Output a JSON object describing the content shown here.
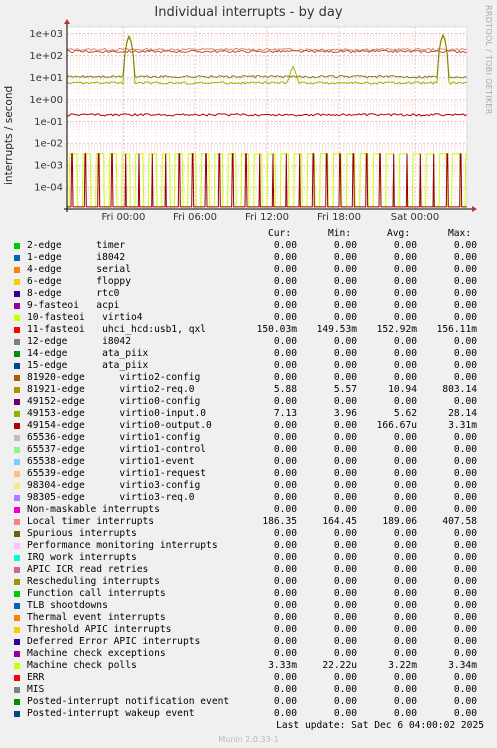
{
  "window": {
    "title": "Individual interrupts - by day",
    "side_label": "RRDTOOL / TOBI OETIKER",
    "last_update": "Last update:  Sat Dec  6 04:00:02 2025",
    "footer": "Munin 2.0.33-1"
  },
  "chart_data": {
    "type": "line",
    "title": "Individual interrupts - by day",
    "ylabel": "interrupts / second",
    "yscale": "log",
    "ylim": [
      1e-05,
      2000
    ],
    "y_ticks": [
      "1e+03",
      "1e+02",
      "1e+01",
      "1e+00",
      "1e-01",
      "1e-02",
      "1e-03",
      "1e-04"
    ],
    "x_ticks": [
      "Fri 00:00",
      "Fri 06:00",
      "Fri 12:00",
      "Fri 18:00",
      "Sat 00:00"
    ],
    "grid": true,
    "series": [
      {
        "name": "Local timer interrupts",
        "color": "#f0797b",
        "approx_level": 189.06,
        "spikes": []
      },
      {
        "name": "11-fasteoi uhci_hcd:usb1, qxl",
        "color": "#a06030",
        "approx_level": 152.92,
        "spikes": []
      },
      {
        "name": "49153-edge virtio0-input.0",
        "color": "#a0b000",
        "approx_level": 5.62,
        "spikes": [
          [
            0.155,
            800
          ],
          [
            0.565,
            25
          ],
          [
            0.94,
            900
          ]
        ]
      },
      {
        "name": "81921-edge virtio2-req.0",
        "color": "#808000",
        "approx_level": 10.94,
        "spikes": [
          [
            0.155,
            700
          ],
          [
            0.94,
            800
          ]
        ]
      },
      {
        "name": "Machine check polls",
        "color": "#bb0000",
        "approx_level": 0.2,
        "spikes": []
      },
      {
        "name": "10-fasteoi virtio4",
        "color": "#ccff00",
        "approx_level": 0.0033,
        "spikes": []
      },
      {
        "name": "49154-edge virtio0-output.0",
        "color": "#990000",
        "approx_level": 0.0033,
        "spikes": []
      }
    ]
  },
  "legend": {
    "headers": {
      "cur": "Cur:",
      "min": "Min:",
      "avg": "Avg:",
      "max": "Max:"
    },
    "rows": [
      {
        "label": "2-edge      timer",
        "color": "#00cc00",
        "cur": "0.00",
        "min": "0.00",
        "avg": "0.00",
        "max": "0.00"
      },
      {
        "label": "1-edge      i8042",
        "color": "#0066b3",
        "cur": "0.00",
        "min": "0.00",
        "avg": "0.00",
        "max": "0.00"
      },
      {
        "label": "4-edge      serial",
        "color": "#ff8000",
        "cur": "0.00",
        "min": "0.00",
        "avg": "0.00",
        "max": "0.00"
      },
      {
        "label": "6-edge      floppy",
        "color": "#ffcc00",
        "cur": "0.00",
        "min": "0.00",
        "avg": "0.00",
        "max": "0.00"
      },
      {
        "label": "8-edge      rtc0",
        "color": "#330099",
        "cur": "0.00",
        "min": "0.00",
        "avg": "0.00",
        "max": "0.00"
      },
      {
        "label": "9-fasteoi   acpi",
        "color": "#990099",
        "cur": "0.00",
        "min": "0.00",
        "avg": "0.00",
        "max": "0.00"
      },
      {
        "label": "10-fasteoi   virtio4",
        "color": "#ccff00",
        "cur": "0.00",
        "min": "0.00",
        "avg": "0.00",
        "max": "0.00"
      },
      {
        "label": "11-fasteoi   uhci_hcd:usb1, qxl",
        "color": "#ff0000",
        "cur": "150.03m",
        "min": "149.53m",
        "avg": "152.92m",
        "max": "156.11m"
      },
      {
        "label": "12-edge      i8042",
        "color": "#808080",
        "cur": "0.00",
        "min": "0.00",
        "avg": "0.00",
        "max": "0.00"
      },
      {
        "label": "14-edge      ata_piix",
        "color": "#008f00",
        "cur": "0.00",
        "min": "0.00",
        "avg": "0.00",
        "max": "0.00"
      },
      {
        "label": "15-edge      ata_piix",
        "color": "#00487d",
        "cur": "0.00",
        "min": "0.00",
        "avg": "0.00",
        "max": "0.00"
      },
      {
        "label": "81920-edge      virtio2-config",
        "color": "#b35a00",
        "cur": "0.00",
        "min": "0.00",
        "avg": "0.00",
        "max": "0.00"
      },
      {
        "label": "81921-edge      virtio2-req.0",
        "color": "#b38f00",
        "cur": "5.88",
        "min": "5.57",
        "avg": "10.94",
        "max": "803.14"
      },
      {
        "label": "49152-edge      virtio0-config",
        "color": "#6b006b",
        "cur": "0.00",
        "min": "0.00",
        "avg": "0.00",
        "max": "0.00"
      },
      {
        "label": "49153-edge      virtio0-input.0",
        "color": "#8fb300",
        "cur": "7.13",
        "min": "3.96",
        "avg": "5.62",
        "max": "28.14"
      },
      {
        "label": "49154-edge      virtio0-output.0",
        "color": "#b30000",
        "cur": "0.00",
        "min": "0.00",
        "avg": "166.67u",
        "max": "3.31m"
      },
      {
        "label": "65536-edge      virtio1-config",
        "color": "#bebebe",
        "cur": "0.00",
        "min": "0.00",
        "avg": "0.00",
        "max": "0.00"
      },
      {
        "label": "65537-edge      virtio1-control",
        "color": "#80ff80",
        "cur": "0.00",
        "min": "0.00",
        "avg": "0.00",
        "max": "0.00"
      },
      {
        "label": "65538-edge      virtio1-event",
        "color": "#80c9ff",
        "cur": "0.00",
        "min": "0.00",
        "avg": "0.00",
        "max": "0.00"
      },
      {
        "label": "65539-edge      virtio1-request",
        "color": "#ffc080",
        "cur": "0.00",
        "min": "0.00",
        "avg": "0.00",
        "max": "0.00"
      },
      {
        "label": "98304-edge      virtio3-config",
        "color": "#ffe680",
        "cur": "0.00",
        "min": "0.00",
        "avg": "0.00",
        "max": "0.00"
      },
      {
        "label": "98305-edge      virtio3-req.0",
        "color": "#aa80ff",
        "cur": "0.00",
        "min": "0.00",
        "avg": "0.00",
        "max": "0.00"
      },
      {
        "label": "Non-maskable interrupts",
        "color": "#ee00cc",
        "cur": "0.00",
        "min": "0.00",
        "avg": "0.00",
        "max": "0.00"
      },
      {
        "label": "Local timer interrupts",
        "color": "#ff8080",
        "cur": "186.35",
        "min": "164.45",
        "avg": "189.06",
        "max": "407.58"
      },
      {
        "label": "Spurious interrupts",
        "color": "#666600",
        "cur": "0.00",
        "min": "0.00",
        "avg": "0.00",
        "max": "0.00"
      },
      {
        "label": "Performance monitoring interrupts",
        "color": "#ffbfff",
        "cur": "0.00",
        "min": "0.00",
        "avg": "0.00",
        "max": "0.00"
      },
      {
        "label": "IRQ work interrupts",
        "color": "#00ffcc",
        "cur": "0.00",
        "min": "0.00",
        "avg": "0.00",
        "max": "0.00"
      },
      {
        "label": "APIC ICR read retries",
        "color": "#cc6699",
        "cur": "0.00",
        "min": "0.00",
        "avg": "0.00",
        "max": "0.00"
      },
      {
        "label": "Rescheduling interrupts",
        "color": "#999900",
        "cur": "0.00",
        "min": "0.00",
        "avg": "0.00",
        "max": "0.00"
      },
      {
        "label": "Function call interrupts",
        "color": "#00cc00",
        "cur": "0.00",
        "min": "0.00",
        "avg": "0.00",
        "max": "0.00"
      },
      {
        "label": "TLB shootdowns",
        "color": "#0066b3",
        "cur": "0.00",
        "min": "0.00",
        "avg": "0.00",
        "max": "0.00"
      },
      {
        "label": "Thermal event interrupts",
        "color": "#ff8000",
        "cur": "0.00",
        "min": "0.00",
        "avg": "0.00",
        "max": "0.00"
      },
      {
        "label": "Threshold APIC interrupts",
        "color": "#ffcc00",
        "cur": "0.00",
        "min": "0.00",
        "avg": "0.00",
        "max": "0.00"
      },
      {
        "label": "Deferred Error APIC interrupts",
        "color": "#330099",
        "cur": "0.00",
        "min": "0.00",
        "avg": "0.00",
        "max": "0.00"
      },
      {
        "label": "Machine check exceptions",
        "color": "#990099",
        "cur": "0.00",
        "min": "0.00",
        "avg": "0.00",
        "max": "0.00"
      },
      {
        "label": "Machine check polls",
        "color": "#ccff00",
        "cur": "3.33m",
        "min": "22.22u",
        "avg": "3.22m",
        "max": "3.34m"
      },
      {
        "label": "ERR",
        "color": "#ff0000",
        "cur": "0.00",
        "min": "0.00",
        "avg": "0.00",
        "max": "0.00"
      },
      {
        "label": "MIS",
        "color": "#808080",
        "cur": "0.00",
        "min": "0.00",
        "avg": "0.00",
        "max": "0.00"
      },
      {
        "label": "Posted-interrupt notification event",
        "color": "#008f00",
        "cur": "0.00",
        "min": "0.00",
        "avg": "0.00",
        "max": "0.00"
      },
      {
        "label": "Posted-interrupt wakeup event",
        "color": "#00487d",
        "cur": "0.00",
        "min": "0.00",
        "avg": "0.00",
        "max": "0.00"
      }
    ]
  }
}
